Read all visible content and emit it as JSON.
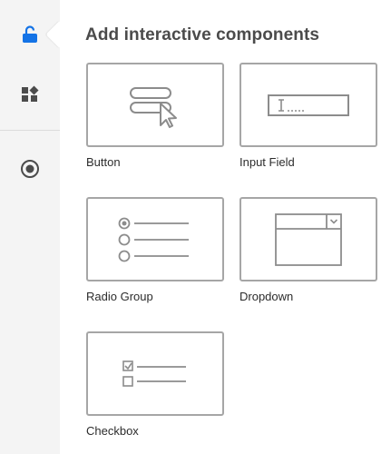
{
  "rail": {
    "items": [
      {
        "icon": "interactive-lock-icon",
        "active": true
      },
      {
        "icon": "components-grid-icon",
        "active": false
      },
      {
        "icon": "record-icon",
        "active": false
      }
    ],
    "accent_color": "#1473e6"
  },
  "panel": {
    "title": "Add interactive components",
    "components": [
      {
        "label": "Button",
        "icon": "button-pointer-icon"
      },
      {
        "label": "Input Field",
        "icon": "text-cursor-field-icon"
      },
      {
        "label": "Radio Group",
        "icon": "radio-list-icon"
      },
      {
        "label": "Dropdown",
        "icon": "dropdown-list-icon"
      },
      {
        "label": "Checkbox",
        "icon": "checkbox-list-icon"
      }
    ]
  },
  "colors": {
    "rail_background": "#f4f4f4",
    "tile_border": "#a6a6a6",
    "icon_stroke": "#8c8c8c",
    "title_text": "#4b4b4b"
  }
}
